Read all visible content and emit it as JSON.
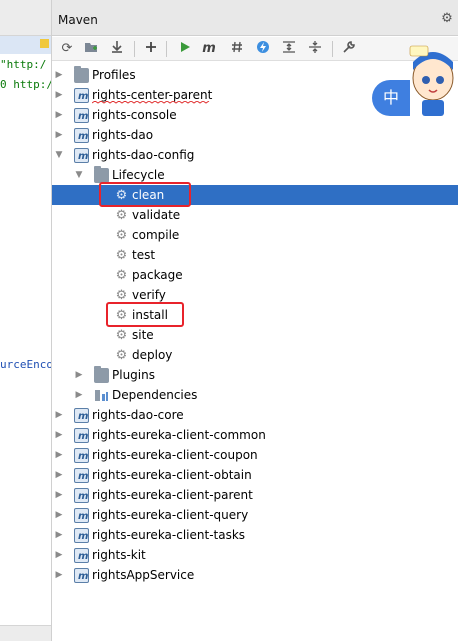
{
  "editor": {
    "code_lines": [
      "\"http:/",
      "0 http:/",
      "urceEnco"
    ]
  },
  "panel": {
    "title": "Maven"
  },
  "toolbar": {
    "buttons": [
      "reload-icon",
      "add-folder-icon",
      "download-icon",
      "plus-icon",
      "run-icon",
      "m-icon",
      "toggle-offline-icon",
      "lightning-icon",
      "expand-icon",
      "collapse-icon",
      "wrench-icon"
    ]
  },
  "tree": {
    "profiles": "Profiles",
    "rights_center_parent": "rights-center-parent",
    "rights_console": "rights-console",
    "rights_dao": "rights-dao",
    "rights_dao_config": "rights-dao-config",
    "lifecycle": "Lifecycle",
    "phases": [
      "clean",
      "validate",
      "compile",
      "test",
      "package",
      "verify",
      "install",
      "site",
      "deploy"
    ],
    "plugins": "Plugins",
    "dependencies": "Dependencies",
    "rights_dao_core": "rights-dao-core",
    "rights_eureka_client_common": "rights-eureka-client-common",
    "rights_eureka_client_coupon": "rights-eureka-client-coupon",
    "rights_eureka_client_obtain": "rights-eureka-client-obtain",
    "rights_eureka_client_parent": "rights-eureka-client-parent",
    "rights_eureka_client_query": "rights-eureka-client-query",
    "rights_eureka_client_tasks": "rights-eureka-client-tasks",
    "rights_kit": "rights-kit",
    "rights_app_service": "rightsAppService"
  },
  "overlay": {
    "badge": "中"
  },
  "colors": {
    "selection": "#2f6fc4",
    "highlight_box": "#e8232b",
    "run_green": "#3a9a3a",
    "badge_blue": "#3f7fe0"
  }
}
